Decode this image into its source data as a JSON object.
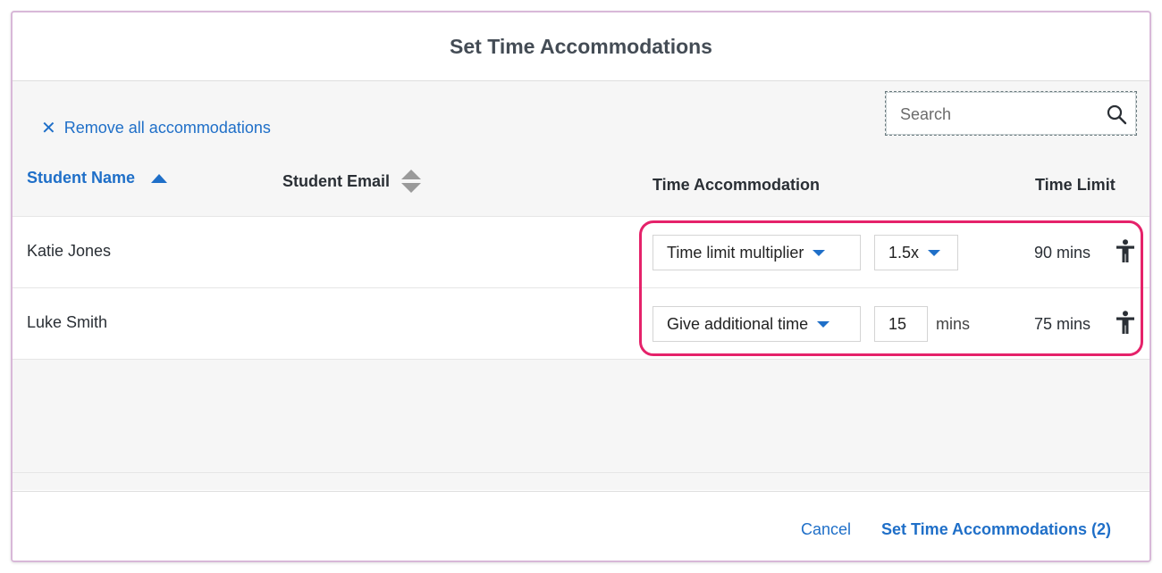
{
  "dialog": {
    "title": "Set Time Accommodations"
  },
  "toolbar": {
    "remove_all_label": "Remove all accommodations",
    "search_placeholder": "Search"
  },
  "table": {
    "columns": [
      {
        "label": "Student Name",
        "sort": "ascending"
      },
      {
        "label": "Student Email",
        "sort": "none"
      },
      {
        "label": "Time Accommodation"
      },
      {
        "label": "Time Limit"
      }
    ],
    "rows": [
      {
        "name": "Katie Jones",
        "accommodation": "Time limit multiplier",
        "value": "1.5x",
        "unit": "",
        "time_limit": "90 mins"
      },
      {
        "name": "Luke Smith",
        "accommodation": "Give additional time",
        "value": "15",
        "unit": "mins",
        "time_limit": "75 mins"
      }
    ]
  },
  "footer": {
    "cancel_label": "Cancel",
    "submit_label": "Set Time Accommodations (2)"
  },
  "colors": {
    "accent": "#1f6fc8",
    "highlight": "#e5226a",
    "body_bg": "#f6f6f6"
  },
  "icons": [
    "close-icon",
    "search-icon",
    "sort-ascending-icon",
    "sort-unsorted-icon",
    "chevron-down-icon",
    "accessibility-person-icon"
  ]
}
